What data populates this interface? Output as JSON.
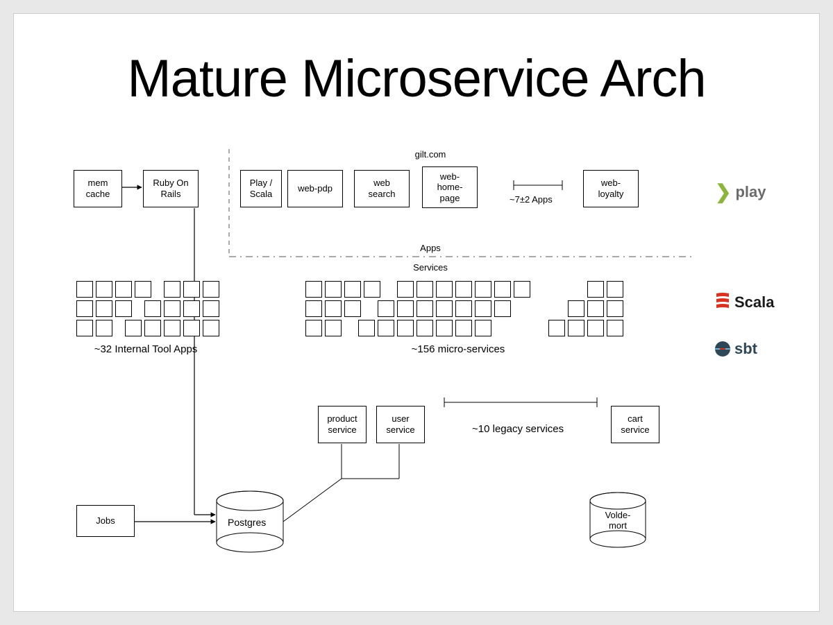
{
  "title": "Mature Microservice Arch",
  "domain_label": "gilt.com",
  "left_top": {
    "memcache": "mem\ncache",
    "ror": "Ruby On\nRails"
  },
  "web_row": {
    "play_scala": "Play /\nScala",
    "pdp": "web-pdp",
    "search": "web\nsearch",
    "home": "web-\nhome-\npage",
    "apps_note": "~7±2 Apps",
    "loyalty": "web-\nloyalty"
  },
  "section_labels": {
    "apps": "Apps",
    "services": "Services"
  },
  "left_cluster_caption": "~32 Internal Tool Apps",
  "right_cluster_caption": "~156 micro-services",
  "legacy": {
    "product": "product\nservice",
    "user": "user\nservice",
    "cart": "cart\nservice",
    "note": "~10 legacy services"
  },
  "bottom": {
    "jobs": "Jobs",
    "postgres": "Postgres",
    "voldemort": "Volde-\nmort"
  },
  "tech": {
    "play": "play",
    "scala": "Scala",
    "sbt": "sbt"
  }
}
